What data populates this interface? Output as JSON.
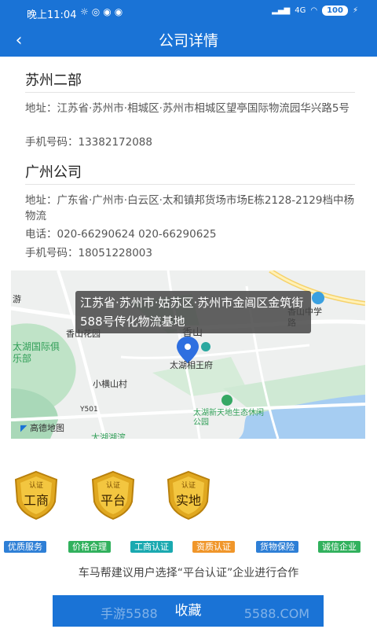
{
  "status_bar": {
    "time": "晚上11:04",
    "signal": "4G",
    "battery": "100"
  },
  "header": {
    "title": "公司详情",
    "back_icon": "chevron-left-icon"
  },
  "branches": [
    {
      "name": "苏州二部",
      "address_label": "地址：",
      "address": "江苏省·苏州市·相城区·苏州市相城区望亭国际物流园华兴路5号",
      "mobile_label": "手机号码：",
      "mobile": "13382172088"
    },
    {
      "name": "广州公司",
      "address_label": "地址：",
      "address": "广东省·广州市·白云区·太和镇邦货场市场E栋2128-2129档中杨物流",
      "phone_label": "电话：",
      "phone": "020-66290624 020-66290625",
      "mobile_label": "手机号码：",
      "mobile": "18051228003"
    }
  ],
  "map": {
    "popup_text": "江苏省·苏州市·姑苏区·苏州市金阊区金筑街588号传化物流基地",
    "labels": [
      "游",
      "香山花园",
      "香山",
      "香山中学",
      "太湖国际俱乐部",
      "太湖相王府",
      "小横山村",
      "Y501",
      "太湖新天地生态休闲公园",
      "太湖湖滨",
      "路"
    ],
    "provider": "高德地图"
  },
  "badges": [
    {
      "small": "认证",
      "big": "工商"
    },
    {
      "small": "认证",
      "big": "平台"
    },
    {
      "small": "认证",
      "big": "实地"
    }
  ],
  "tags": [
    {
      "label": "优质服务",
      "color": "#2e7fd6"
    },
    {
      "label": "价格合理",
      "color": "#31b15d"
    },
    {
      "label": "工商认证",
      "color": "#1aa9b0"
    },
    {
      "label": "资质认证",
      "color": "#f0962a"
    },
    {
      "label": "货物保险",
      "color": "#2e7fd6"
    },
    {
      "label": "诚信企业",
      "color": "#31b15d"
    }
  ],
  "tip": "车马帮建议用户选择“平台认证”企业进行合作",
  "favorite_label": "收藏",
  "watermark": "手游5588",
  "watermark_domain": "5588.COM"
}
